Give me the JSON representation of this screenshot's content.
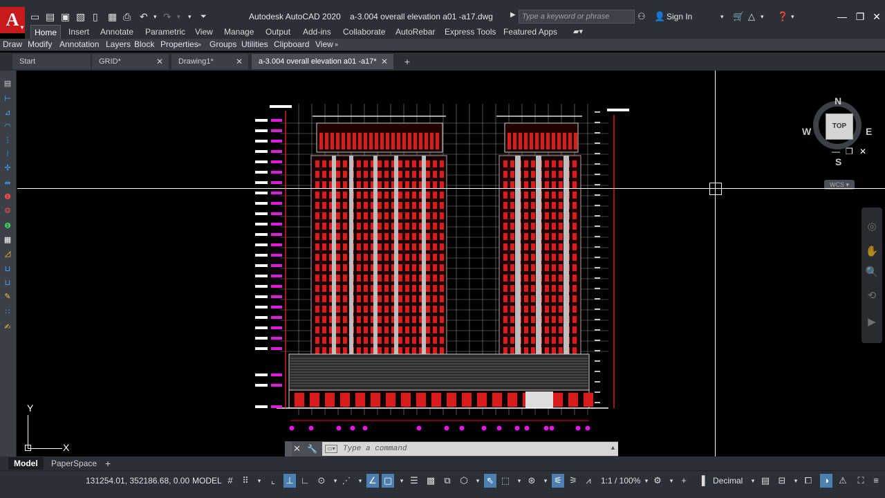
{
  "app": {
    "logo_letter": "A",
    "title": "Autodesk AutoCAD 2020",
    "filename": "a-3.004 overall elevation a01 -a17.dwg"
  },
  "search": {
    "placeholder": "Type a keyword or phrase"
  },
  "account": {
    "sign_in": "Sign In"
  },
  "ribbon_tabs": [
    {
      "label": "Home",
      "active": true
    },
    {
      "label": "Insert"
    },
    {
      "label": "Annotate"
    },
    {
      "label": "Parametric"
    },
    {
      "label": "View"
    },
    {
      "label": "Manage"
    },
    {
      "label": "Output"
    },
    {
      "label": "Add-ins"
    },
    {
      "label": "Collaborate"
    },
    {
      "label": "AutoRebar"
    },
    {
      "label": "Express Tools"
    },
    {
      "label": "Featured Apps"
    }
  ],
  "ribbon_panels": [
    "Draw",
    "Modify",
    "Annotation",
    "Layers",
    "Block",
    "Properties",
    "Groups",
    "Utilities",
    "Clipboard",
    "View"
  ],
  "file_tabs": [
    {
      "label": "Start"
    },
    {
      "label": "GRID*"
    },
    {
      "label": "Drawing1*"
    },
    {
      "label": "a-3.004 overall elevation a01 -a17*",
      "active": true
    }
  ],
  "viewcube": {
    "north": "N",
    "south": "S",
    "east": "E",
    "west": "W",
    "face": "TOP",
    "ucs": "WCS"
  },
  "ucs_icon": {
    "x_label": "X",
    "y_label": "Y"
  },
  "command": {
    "placeholder": "Type a command"
  },
  "layout_tabs": [
    {
      "label": "Model",
      "active": true
    },
    {
      "label": "PaperSpace"
    }
  ],
  "status": {
    "coordinates": "131254.01, 352186.68, 0.00",
    "space": "MODEL",
    "annotation_scale": "1:1 / 100%",
    "units": "Decimal"
  },
  "colors": {
    "ribbon_bg": "#2b2f36",
    "panel_bg": "#3b4048",
    "canvas_bg": "#000000",
    "building_red": "#d81d1d",
    "grid_grey": "#8a8a8a",
    "dimension_magenta": "#e01adf",
    "crosshair": "#ffffff",
    "active_toggle": "#4d7fb0"
  }
}
